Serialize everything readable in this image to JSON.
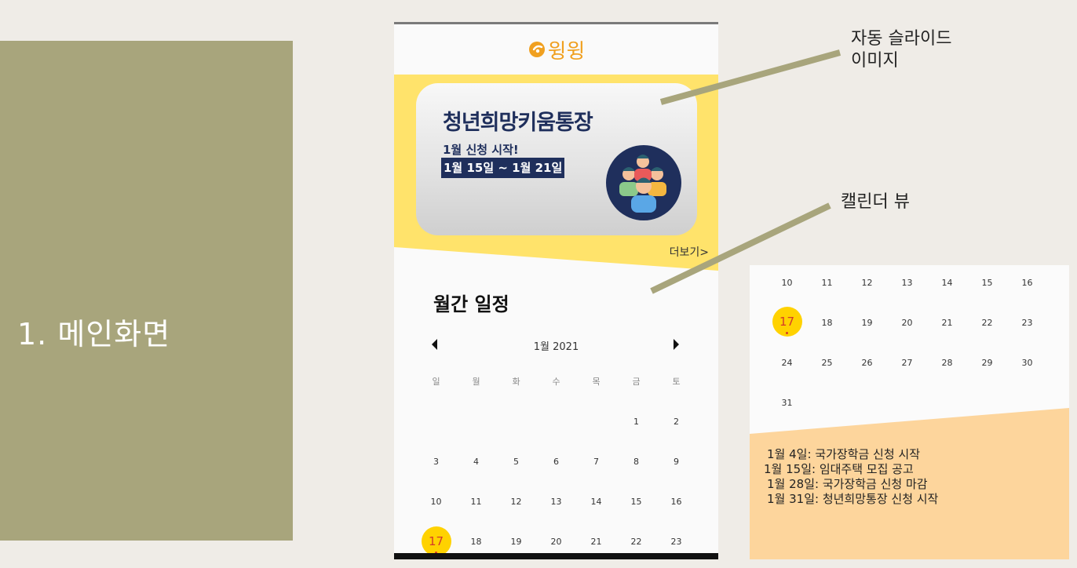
{
  "slide": {
    "title": "1. 메인화면"
  },
  "app": {
    "logo_text": "윙윙",
    "banner": {
      "title": "청년희망키움통장",
      "subtitle": "1월 신청 시작!",
      "date_range": "1월 15일 ~ 1월 21일"
    },
    "more_label": "더보기>",
    "section_title": "월간 일정",
    "calendar": {
      "month_label": "1월 2021",
      "weekdays": [
        "일",
        "월",
        "화",
        "수",
        "목",
        "금",
        "토"
      ],
      "weeks": [
        [
          "",
          "",
          "",
          "",
          "",
          "1",
          "2"
        ],
        [
          "3",
          "4",
          "5",
          "6",
          "7",
          "8",
          "9"
        ],
        [
          "10",
          "11",
          "12",
          "13",
          "14",
          "15",
          "16"
        ],
        [
          "17",
          "18",
          "19",
          "20",
          "21",
          "22",
          "23"
        ]
      ],
      "today": "17"
    }
  },
  "callouts": {
    "slider": "자동 슬라이드\n이미지",
    "calendar": "캘린더 뷰"
  },
  "zoom": {
    "weeks": [
      [
        "10",
        "11",
        "12",
        "13",
        "14",
        "15",
        "16"
      ],
      [
        "17",
        "18",
        "19",
        "20",
        "21",
        "22",
        "23"
      ],
      [
        "24",
        "25",
        "26",
        "27",
        "28",
        "29",
        "30"
      ],
      [
        "31",
        "",
        "",
        "",
        "",
        "",
        ""
      ]
    ],
    "events": [
      "1월 4일: 국가장학금 신청 시작",
      "1월 15일: 임대주택 모집 공고",
      "1월 28일: 국가장학금 신청 마감",
      "1월 31일: 청년희망통장 신청 시작"
    ]
  },
  "colors": {
    "olive": "#a8a57c",
    "banner_yellow": "#ffe36b",
    "today_yellow": "#ffd200",
    "events_orange": "#fdd59c",
    "navy": "#1f2f5c"
  }
}
